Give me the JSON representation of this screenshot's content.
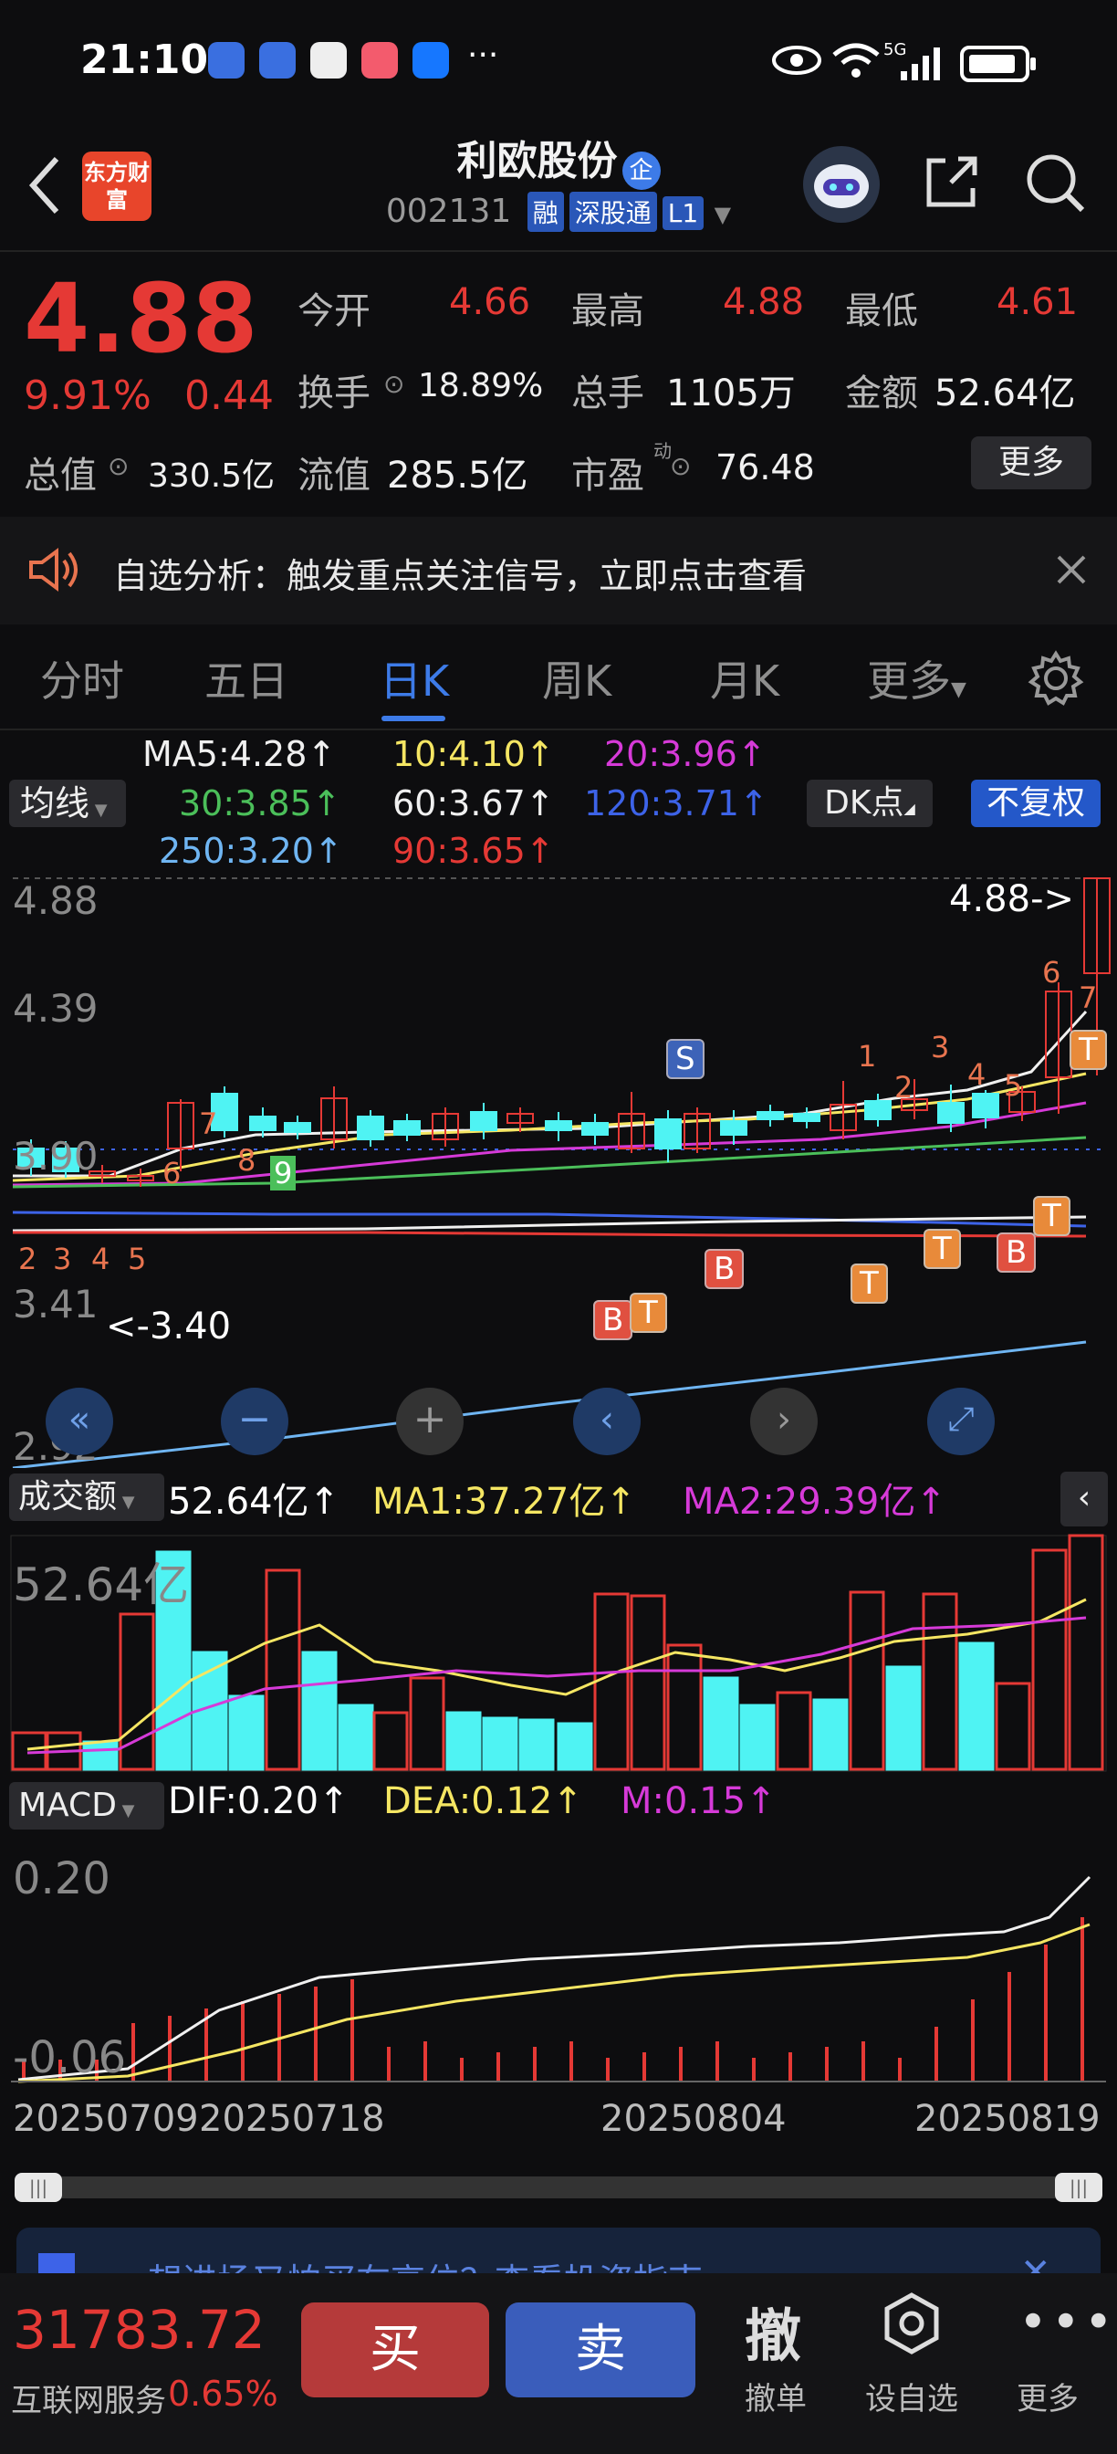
{
  "status_bar": {
    "time": "21:10",
    "network": "5G"
  },
  "header": {
    "logo_text": "东方财富",
    "stock_name": "利欧股份",
    "badge": "企",
    "code": "002131",
    "tags": [
      "融",
      "深股通",
      "L1"
    ]
  },
  "quote": {
    "price": "4.88",
    "change_pct": "9.91%",
    "change": "0.44",
    "open_label": "今开",
    "open": "4.66",
    "high_label": "最高",
    "high": "4.88",
    "low_label": "最低",
    "low": "4.61",
    "turnover_label": "换手",
    "turnover": "18.89%",
    "volume_label": "总手",
    "volume": "1105万",
    "amount_label": "金额",
    "amount": "52.64亿",
    "mcap_label": "总值",
    "mcap": "330.5亿",
    "float_label": "流值",
    "float": "285.5亿",
    "pe_label": "市盈",
    "pe_sup": "动",
    "pe": "76.48",
    "more_label": "更多"
  },
  "notice": {
    "text": "自选分析：触发重点关注信号，立即点击查看"
  },
  "tabs": [
    "分时",
    "五日",
    "日K",
    "周K",
    "月K",
    "更多"
  ],
  "active_tab": "日K",
  "ma": {
    "selector": "均线",
    "ma5": "MA5:4.28",
    "ma10": "10:4.10",
    "ma20": "20:3.96",
    "ma30": "30:3.85",
    "ma60": "60:3.67",
    "ma120": "120:3.71",
    "ma250": "250:3.20",
    "ma90": "90:3.65",
    "dk_label": "DK点",
    "fq_label": "不复权"
  },
  "kline": {
    "y_labels": [
      "4.88",
      "4.39",
      "3.90",
      "3.41",
      "2.92"
    ],
    "high_marker": "4.88->",
    "low_marker": "<-3.40",
    "count_up": [
      "2",
      "3",
      "4",
      "5",
      "6",
      "7",
      "8",
      "9"
    ],
    "count_up2": [
      "1",
      "2",
      "3",
      "4",
      "5",
      "6",
      "7"
    ],
    "signals": [
      "S",
      "B",
      "T",
      "B",
      "T",
      "T",
      "B",
      "T",
      "T"
    ]
  },
  "volume": {
    "selector": "成交额",
    "value": "52.64亿",
    "ma1": "MA1:37.27亿",
    "ma2": "MA2:29.39亿",
    "y_label": "52.64亿"
  },
  "macd": {
    "selector": "MACD",
    "dif": "DIF:0.20",
    "dea": "DEA:0.12",
    "m": "M:0.15",
    "y_top": "0.20",
    "y_bottom": "-0.06"
  },
  "dates": [
    "20250709",
    "20250718",
    "20250804",
    "20250819"
  ],
  "promo": {
    "text": "想进场又怕买在高位？查看投资指南"
  },
  "bottom": {
    "index_value": "31783.72",
    "index_name": "互联网服务",
    "index_change": "0.65%",
    "buy": "买",
    "sell": "卖",
    "cancel_icon": "撤",
    "cancel": "撤单",
    "watch": "设自选",
    "more": "更多"
  },
  "colors": {
    "up": "#e53935",
    "down": "#4ff3f3",
    "accent": "#3d7be8"
  }
}
